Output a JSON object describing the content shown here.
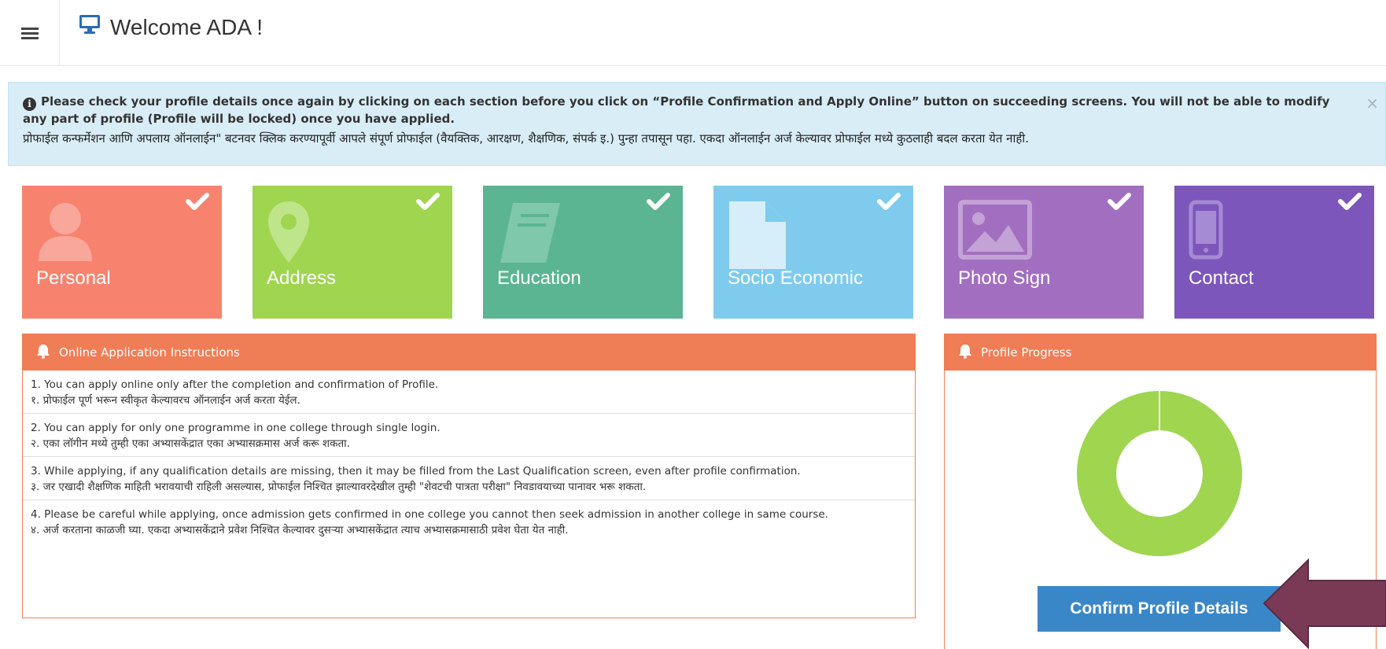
{
  "header": {
    "welcome_text": "Welcome ADA !"
  },
  "alert": {
    "line1": "Please check your profile details once again by clicking on each section before you click on “Profile Confirmation and Apply Online” button on succeeding screens. You will not be able to modify any part of profile (Profile will be locked) once you have applied.",
    "line2": "प्रोफाईल कन्फर्मेशन आणि अपलाय ऑनलाईन\" बटनवर क्लिक करण्यापूर्वी आपले संपूर्ण प्रोफाईल (वैयक्तिक, आरक्षण, शैक्षणिक, संपर्क इ.) पुन्हा तपासून पहा. एकदा ऑनलाईन अर्ज केल्यावर प्रोफाईल मध्ये कुठलाही बदल करता येत नाही.",
    "close_label": "×"
  },
  "tiles": [
    {
      "label": "Personal",
      "color": "#f7836f",
      "icon": "user-icon",
      "completed": true
    },
    {
      "label": "Address",
      "color": "#9fd54f",
      "icon": "map-marker-icon",
      "completed": true
    },
    {
      "label": "Education",
      "color": "#5bb592",
      "icon": "book-icon",
      "completed": true
    },
    {
      "label": "Socio Economic",
      "color": "#7ecbee",
      "icon": "document-icon",
      "completed": true
    },
    {
      "label": "Photo Sign",
      "color": "#a26fc0",
      "icon": "image-icon",
      "completed": true
    },
    {
      "label": "Contact",
      "color": "#7d56bb",
      "icon": "mobile-icon",
      "completed": true
    }
  ],
  "instructions": {
    "title": "Online Application Instructions",
    "items": [
      {
        "en": "1. You can apply online only after the completion and confirmation of Profile.",
        "mr": "१. प्रोफाईल पूर्ण भरून स्वीकृत केल्यावरच ऑनलाईन अर्ज करता येईल."
      },
      {
        "en": "2. You can apply for only one programme in one college through single login.",
        "mr": "२. एका लॉगीन मध्ये तुम्ही एका अभ्यासकेंद्रात एका अभ्यासक्रमास अर्ज करू शकता."
      },
      {
        "en": "3. While applying, if any qualification details are missing, then it may be filled from the Last Qualification screen, even after profile confirmation.",
        "mr": "३. जर एखादी शैक्षणिक माहिती भरावयाची राहिली असल्यास, प्रोफाईल निश्चित झाल्यावरदेखील तुम्ही \"शेवटची पात्रता परीक्षा\" निवडावयाच्या पानावर भरू शकता."
      },
      {
        "en": "4. Please be careful while applying, once admission gets confirmed in one college you cannot then seek admission in another college in same course.",
        "mr": "४. अर्ज करताना काळजी घ्या. एकदा अभ्यासकेंद्राने प्रवेश निश्चित केल्यावर दुसऱ्या अभ्यासकेंद्रात त्याच अभ्यासक्रमासाठी प्रवेश घेता येत नाही."
      }
    ]
  },
  "progress": {
    "title": "Profile Progress",
    "percent_complete": 100,
    "fill_color": "#9fd54f",
    "confirm_label": "Confirm Profile Details"
  },
  "colors": {
    "header_orange": "#ef7d56",
    "alert_bg": "#d9edf7",
    "button_blue": "#3a87c8",
    "arrow_color": "#7a3a55"
  }
}
